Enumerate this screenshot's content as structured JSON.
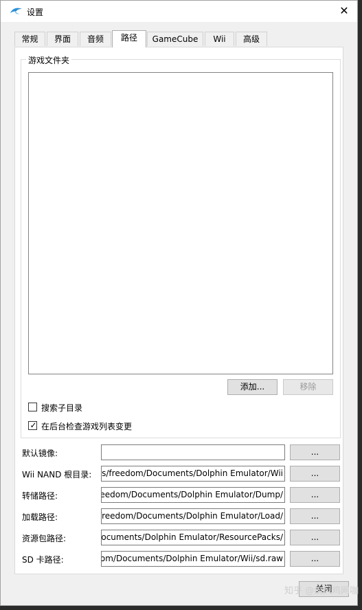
{
  "window": {
    "title": "设置",
    "close_glyph": "✕"
  },
  "tabs": [
    "常规",
    "界面",
    "音频",
    "路径",
    "GameCube",
    "Wii",
    "高级"
  ],
  "active_tab": "路径",
  "game_folders": {
    "group_title": "游戏文件夹",
    "add_button": "添加...",
    "remove_button": "移除",
    "recursive_label": "搜索子目录",
    "recursive_checked": false,
    "auto_check_label": "在后台检查游戏列表变更",
    "auto_check_checked": true
  },
  "paths": [
    {
      "label": "默认镜像:",
      "value": "",
      "button": "..."
    },
    {
      "label": "Wii NAND 根目录:",
      "value": "rs/freedom/Documents/Dolphin Emulator/Wii",
      "button": "..."
    },
    {
      "label": "转储路径:",
      "value": "eedom/Documents/Dolphin Emulator/Dump/",
      "button": "..."
    },
    {
      "label": "加载路径:",
      "value": "freedom/Documents/Dolphin Emulator/Load/",
      "button": "..."
    },
    {
      "label": "资源包路径:",
      "value": "Documents/Dolphin Emulator/ResourcePacks/",
      "button": "..."
    },
    {
      "label": "SD 卡路径:",
      "value": "om/Documents/Dolphin Emulator/Wii/sd.raw",
      "button": "..."
    }
  ],
  "footer": {
    "close_button": "关闭"
  },
  "watermark": "知乎 @疾风鸡网咖",
  "colors": {
    "accent_icon": "#2a8fd6",
    "check": "#000000"
  },
  "icons": {
    "app": "dolphin-icon",
    "close": "close-icon",
    "check": "checkmark-icon"
  }
}
